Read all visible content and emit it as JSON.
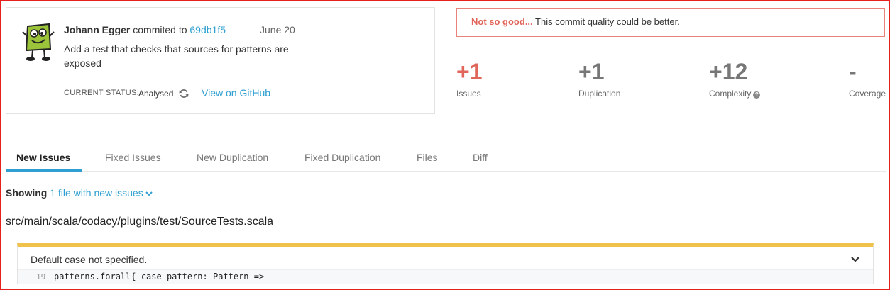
{
  "commit": {
    "author": "Johann Egger",
    "verb": "commited to",
    "hash": "69db1f5",
    "date": "June 20",
    "message": "Add a test that checks that sources for patterns are exposed",
    "status_label": "CURRENT STATUS:",
    "status_value": "Analysed",
    "github_link": "View on GitHub"
  },
  "quality": {
    "verdict": "Not so good...",
    "text": " This commit quality could be better."
  },
  "metrics": [
    {
      "value": "+1",
      "label": "Issues",
      "color": "#e0665b"
    },
    {
      "value": "+1",
      "label": "Duplication",
      "color": "#777777"
    },
    {
      "value": "+12",
      "label": "Complexity",
      "color": "#777777"
    },
    {
      "value": "-",
      "label": "Coverage",
      "color": "#777777"
    }
  ],
  "tabs": [
    "New Issues",
    "Fixed Issues",
    "New Duplication",
    "Fixed Duplication",
    "Files",
    "Diff"
  ],
  "active_tab": "New Issues",
  "showing": {
    "label": "Showing",
    "link": "1 file with new issues"
  },
  "file_path": "src/main/scala/codacy/plugins/test/SourceTests.scala",
  "issue": {
    "title": "Default case not specified.",
    "line_number": "19",
    "code": "patterns.forall{ case pattern: Pattern =>"
  },
  "colors": {
    "accent": "#2e9fd0",
    "bad": "#e0665b",
    "warning_bar": "#f1c24b",
    "frame": "#e8201c"
  }
}
